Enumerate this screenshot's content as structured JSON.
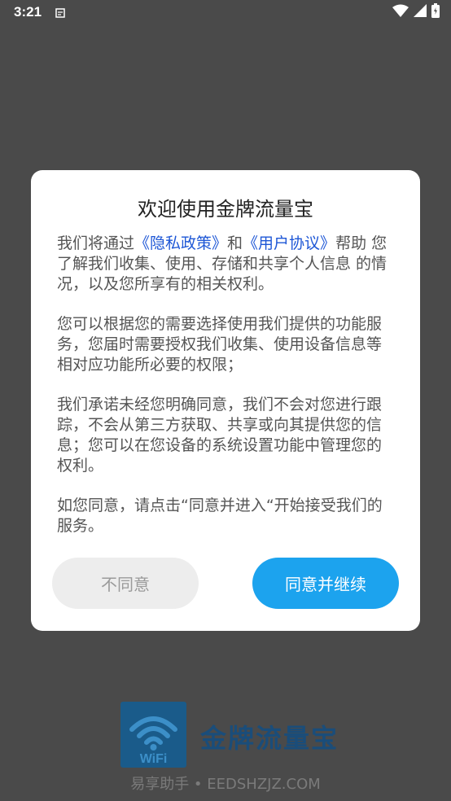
{
  "status_bar": {
    "time": "3:21"
  },
  "dialog": {
    "title": "欢迎使用金牌流量宝",
    "p1_before": "我们将通过",
    "privacy_link": "《隐私政策》",
    "p1_and": "和",
    "agreement_link": "《用户协议》",
    "p1_after": "帮助 您了解我们收集、使用、存储和共享个人信息 的情况，以及您所享有的相关权利。",
    "p2": "您可以根据您的需要选择使用我们提供的功能服务，您届时需要授权我们收集、使用设备信息等相对应功能所必要的权限；",
    "p3": "我们承诺未经您明确同意，我们不会对您进行跟踪，不会从第三方获取、共享或向其提供您的信息；您可以在您设备的系统设置功能中管理您的权利。",
    "p4": "如您同意，请点击“同意并进入“开始接受我们的服务。",
    "disagree_label": "不同意",
    "agree_label": "同意并继续"
  },
  "branding": {
    "logo_text": "WiFi",
    "app_name": "金牌流量宝",
    "footer": "易享助手 • EEDSHZJZ.COM"
  },
  "colors": {
    "overlay": "#4a4a4a",
    "link": "#1e57d6",
    "agree_button": "#1ca3ee",
    "disagree_button": "#ededed"
  }
}
